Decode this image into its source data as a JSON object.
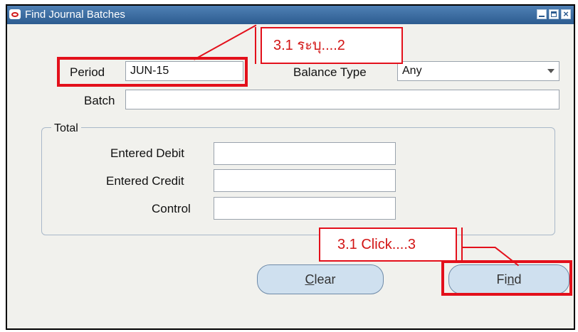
{
  "window": {
    "title": "Find Journal Batches"
  },
  "period": {
    "label": "Period",
    "value": "JUN-15"
  },
  "balance_type": {
    "label": "Balance Type",
    "value": "Any"
  },
  "batch": {
    "label": "Batch",
    "value": ""
  },
  "total_group": {
    "title": "Total",
    "entered_debit_label": "Entered Debit",
    "entered_credit_label": "Entered Credit",
    "control_label": "Control"
  },
  "buttons": {
    "clear": {
      "mnemonic": "C",
      "rest": "lear"
    },
    "find": {
      "prefix": "Fi",
      "mnemonic": "n",
      "rest": "d"
    }
  },
  "annotations": {
    "callout_period": "3.1 ระบุ....2",
    "callout_find": "3.1 Click....3",
    "highlight_color": "#e3101b"
  }
}
